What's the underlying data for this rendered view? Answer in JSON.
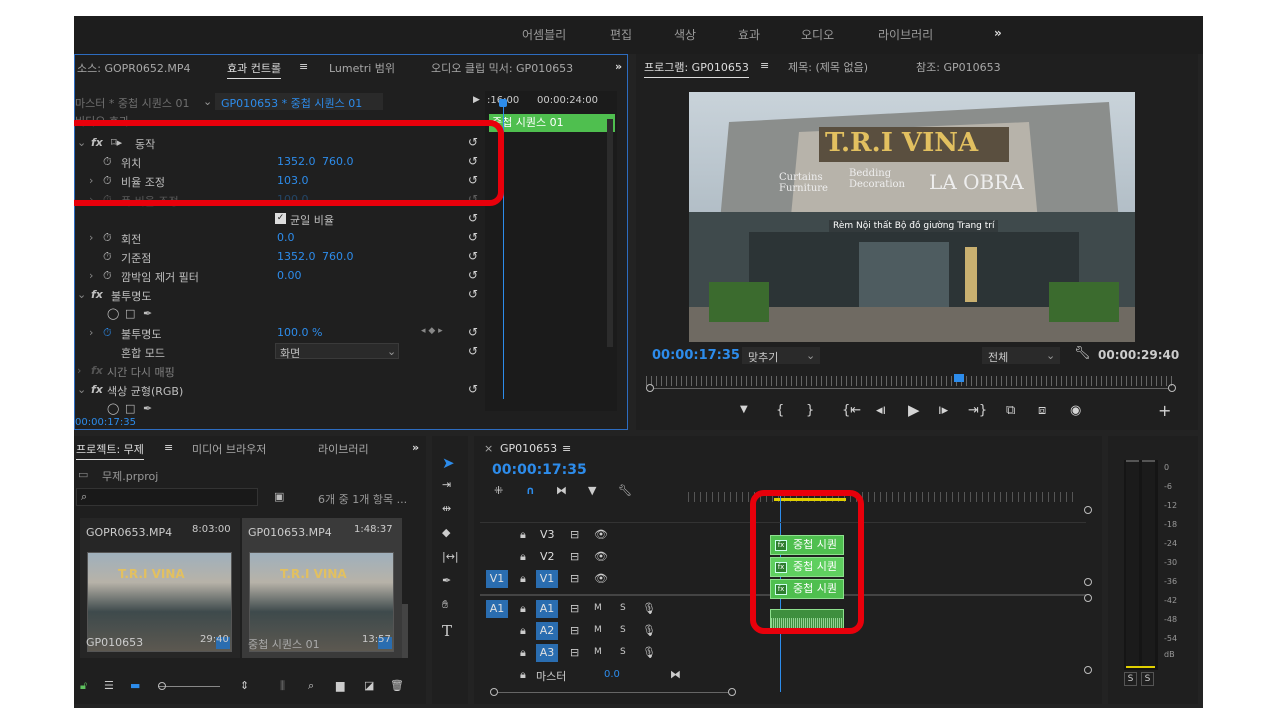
{
  "workspace": {
    "tabs": [
      "어셈블리",
      "편집",
      "색상",
      "효과",
      "오디오",
      "라이브러리"
    ],
    "more": "»"
  },
  "effect_panel": {
    "tabs": [
      "소스: GOPR0652.MP4",
      "효과 컨트롤",
      "Lumetri 범위",
      "오디오 클립 믹서: GP010653"
    ],
    "active_tab_menu": "≡",
    "master_clip": "마스터 * 중첩 시퀀스 01",
    "sequence_clip": "GP010653 * 중첩 시퀀스 01",
    "section_video": "비디오 효과",
    "timecode_a": ":16:00",
    "timecode_b": "00:00:24:00",
    "clip_label": "중첩 시퀀스 01",
    "motion": "동작",
    "position_label": "위치",
    "position_x": "1352.0",
    "position_y": "760.0",
    "scale_label": "비율 조정",
    "scale_value": "103.0",
    "scale_width_label": "폭 비율 조정",
    "scale_width_value": "100.0",
    "uniform_scale": "균일 비율",
    "rotation_label": "회전",
    "rotation_value": "0.0",
    "anchor_label": "기준점",
    "anchor_x": "1352.0",
    "anchor_y": "760.0",
    "flicker_label": "깜박임 제거 필터",
    "flicker_value": "0.00",
    "opacity_section": "불투명도",
    "opacity_label": "불투명도",
    "opacity_value": "100.0 %",
    "blend_label": "혼합 모드",
    "blend_value": "화면",
    "time_remap": "시간 다시 매핑",
    "color_balance": "색상 균형(RGB)",
    "current_time": "00:00:17:35"
  },
  "program": {
    "tabs": [
      "프로그램: GP010653",
      "제목: (제목 없음)",
      "참조: GP010653"
    ],
    "menu": "≡",
    "timecode": "00:00:17:35",
    "fit": "맞추기",
    "quality": "전체",
    "duration": "00:00:29:40",
    "sign_main": "T.R.I VINA",
    "sign_left": "Curtains Furniture",
    "sign_mid": "Bedding Decoration",
    "sign_right": "LA OBRA",
    "sign_banner": "Rèm  Nội thất  Bộ đồ giường  Trang trí"
  },
  "project": {
    "tabs": [
      "프로젝트: 무제",
      "미디어 브라우저",
      "라이브러리"
    ],
    "menu": "≡",
    "file": "무제.prproj",
    "count": "6개 중 1개 항목 ...",
    "items": [
      {
        "name": "GOPR0653.MP4",
        "duration": "8:03:00",
        "label": "GP010653",
        "time": "29:40"
      },
      {
        "name": "GP010653.MP4",
        "duration": "1:48:37",
        "label": "중첩 시퀀스 01",
        "time": "13:57"
      }
    ]
  },
  "timeline": {
    "title": "GP010653",
    "menu": "≡",
    "timecode": "00:00:17:35",
    "tracks": [
      {
        "id": "V3"
      },
      {
        "id": "V2"
      },
      {
        "id": "V1",
        "src": "V1"
      },
      {
        "id": "A1",
        "src": "A1"
      },
      {
        "id": "A2"
      },
      {
        "id": "A3"
      }
    ],
    "master": "마스터",
    "master_value": "0.0",
    "clip_label": "중첩 시퀀스 01",
    "clip_visible": "중첩 시퀀",
    "m": "M",
    "s": "S"
  },
  "meter": {
    "labels": [
      "0",
      "-6",
      "-12",
      "-18",
      "-24",
      "-30",
      "-36",
      "-42",
      "-48",
      "-54",
      "dB"
    ],
    "solo": "S"
  },
  "colors": {
    "accent": "#2d8ceb",
    "clip": "#4fbf4f",
    "highlight": "#e8000b",
    "track_btn": "#2a6db0"
  }
}
